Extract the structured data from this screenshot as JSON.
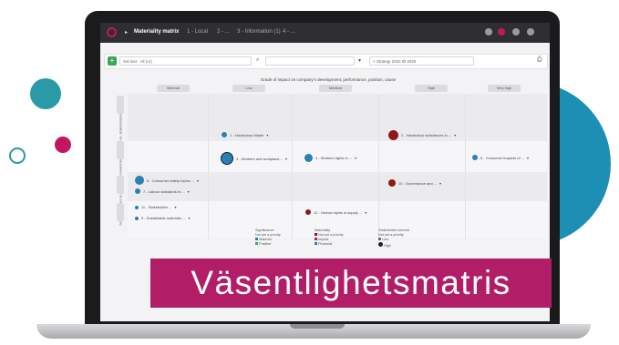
{
  "app": {
    "title": "Materiality matrix",
    "breadcrumbs": [
      "1 - Local",
      "2 - ...",
      "3 - Information (1)",
      "4 - ..."
    ],
    "toolbar": {
      "add_label": "+",
      "filter1": "Set last",
      "filter1_value": "All (or)",
      "filter2": "",
      "filter3": "× Strategi 2022 till 2025"
    }
  },
  "matrix": {
    "title": "Grade of impact on company’s development, performance, position, cause",
    "columns": [
      "Minimal",
      "Low",
      "Medium",
      "High",
      "Very high"
    ],
    "y_axis_label": "Grade of impact on people and environment, outside-in, stakeholders",
    "items": [
      {
        "label": "1 - Hazardous Waste",
        "color": "#2a7fb3"
      },
      {
        "label": "2 - Hazardous substances in ...",
        "color": "#8b1a1a"
      },
      {
        "label": "3 - Workers and workplace...",
        "color": "#2a7fb3"
      },
      {
        "label": "4 - Workers rights in ...",
        "color": "#2a7fb3"
      },
      {
        "label": "5 - Consumer impacts of ...",
        "color": "#2a7fb3"
      },
      {
        "label": "6 - Consumer safety topics ...",
        "color": "#2a7fb3"
      },
      {
        "label": "7 - Labour standards in ...",
        "color": "#8b1a1a"
      },
      {
        "label": "8 - Climate and energy ...",
        "color": "#2a7fb3"
      },
      {
        "label": "9 - Sustainable materials ...",
        "color": "#2a7fb3"
      },
      {
        "label": "10 - Governance and ...",
        "color": "#8b1a1a"
      },
      {
        "label": "11 - Stakeholder ...",
        "color": "#2a7fb3"
      },
      {
        "label": "12 - Human rights in supply ...",
        "color": "#8b1a1a"
      }
    ],
    "legend": [
      {
        "title": "Significance",
        "entries": [
          "Not yet a priority",
          "Material",
          "Positive"
        ]
      },
      {
        "title": "Materiality",
        "entries": [
          "Not yet a priority",
          "Impact",
          "Financial"
        ]
      },
      {
        "title": "Stakeholder interest",
        "entries": [
          "Not yet a priority",
          "Low",
          "High"
        ]
      }
    ]
  },
  "banner": {
    "text": "Väsentlighetsmatris",
    "color": "#b11d66"
  },
  "colors": {
    "teal": "#2a9aa6",
    "magenta": "#c2185b",
    "blue": "#1e8fb4"
  }
}
